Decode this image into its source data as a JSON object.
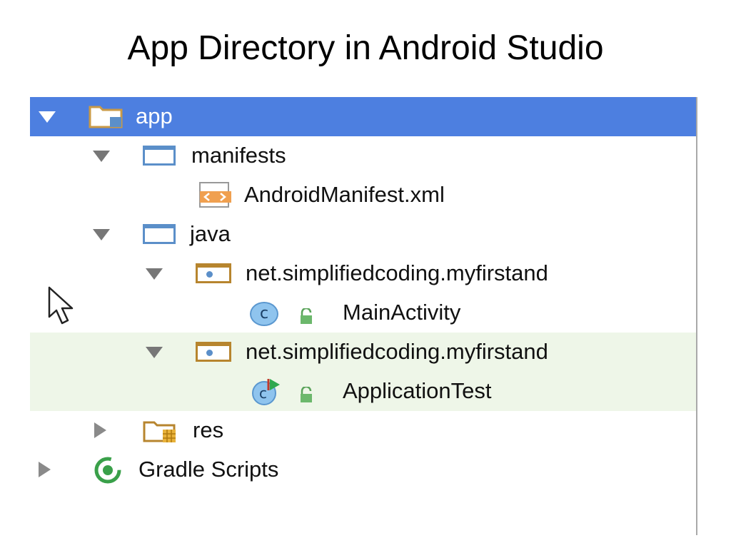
{
  "slide": {
    "title": "App Directory in Android Studio"
  },
  "tree": {
    "items": [
      {
        "label": "app"
      },
      {
        "label": "manifests"
      },
      {
        "label": "AndroidManifest.xml"
      },
      {
        "label": "java"
      },
      {
        "label": "net.simplifiedcoding.myfirstand"
      },
      {
        "label": "MainActivity"
      },
      {
        "label": "net.simplifiedcoding.myfirstand"
      },
      {
        "label": "ApplicationTest"
      },
      {
        "label": "res"
      },
      {
        "label": "Gradle Scripts"
      }
    ]
  },
  "icons": {
    "app": "folder-app-icon",
    "manifests": "folder-icon",
    "manifest_file": "xml-file-icon",
    "java": "folder-icon",
    "package": "package-folder-icon",
    "class": "class-icon",
    "test_class": "test-class-icon",
    "lock": "lock-icon",
    "res": "resource-folder-icon",
    "gradle": "gradle-icon"
  },
  "colors": {
    "selection": "#4d7fe0",
    "test_band": "#eef6e8",
    "folder": "#5b8fc9",
    "package_folder": "#b7852e"
  }
}
